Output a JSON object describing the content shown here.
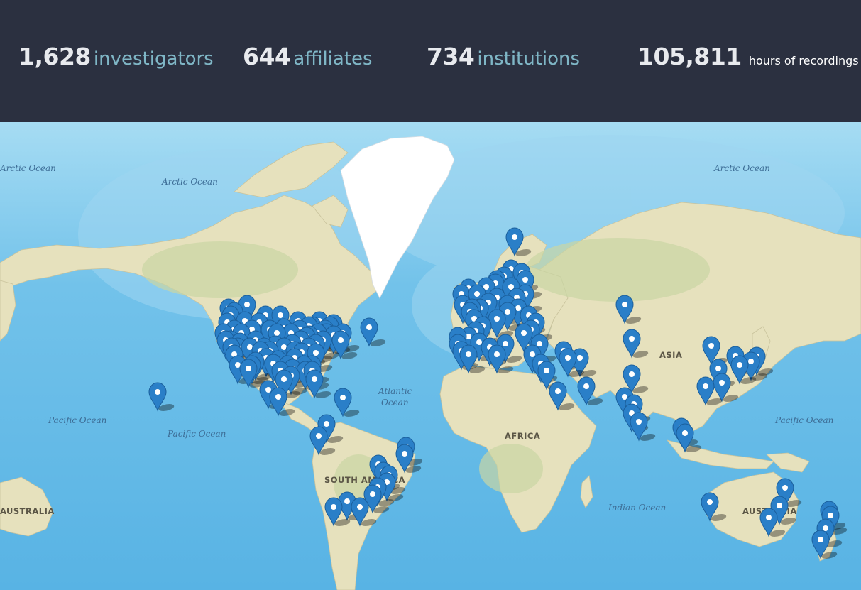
{
  "stats": [
    {
      "value": "1,628",
      "label": "investigators"
    },
    {
      "value": "644",
      "label": "affiliates"
    },
    {
      "value": "734",
      "label": "institutions"
    },
    {
      "value": "105,811",
      "label": "hours of recordings"
    }
  ],
  "map": {
    "ocean_labels": [
      "Arctic Ocean",
      "Arctic Ocean",
      "Arctic Ocean",
      "Pacific Ocean",
      "Pacific Ocean",
      "Atlantic Ocean",
      "Pacific Ocean",
      "Indian Ocean"
    ],
    "region_labels": [
      "ASIA",
      "AFRICA",
      "SOUTH AMERICA",
      "AUSTRALIA",
      "AUSTRALIA"
    ],
    "marker_icon": "map-pin-icon",
    "colors": {
      "header_bg": "#2b3040",
      "stat_number": "#e8eaee",
      "stat_label": "#7fb6c6",
      "ocean": "#6cc0ea",
      "land": "#e6e1bd",
      "greenland": "#ffffff",
      "marker": "#2a7fc8"
    }
  }
}
